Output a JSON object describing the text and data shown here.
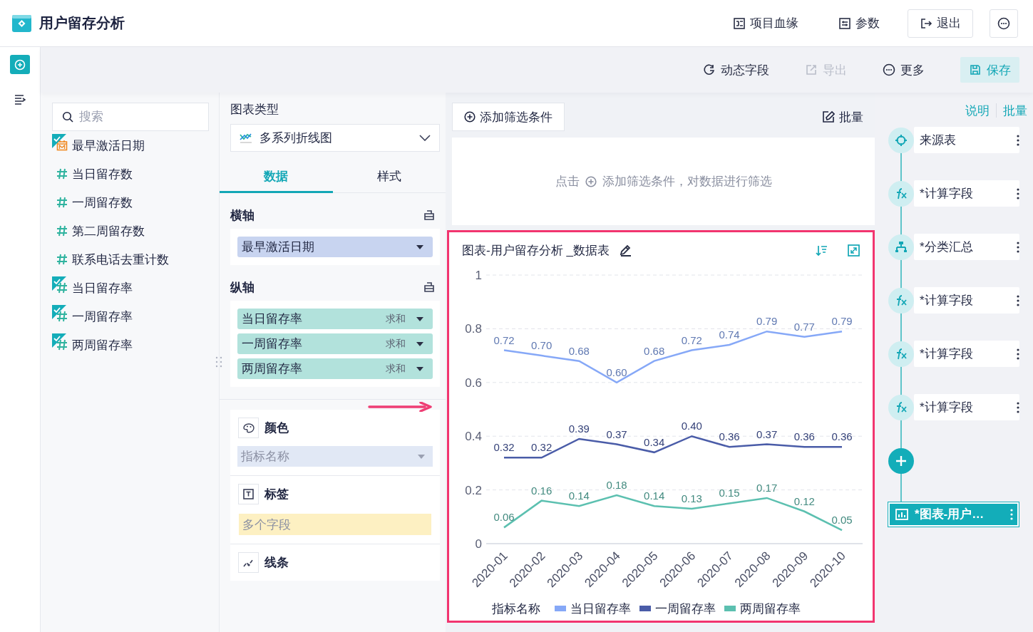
{
  "app": {
    "title": "用户留存分析"
  },
  "header_actions": [
    {
      "kind": "lineage",
      "label": "项目血缘"
    },
    {
      "kind": "params",
      "label": "参数"
    },
    {
      "kind": "exit",
      "label": "退出"
    },
    {
      "kind": "more"
    }
  ],
  "toolbar": [
    {
      "kind": "dynamic",
      "label": "动态字段",
      "disabled": false
    },
    {
      "kind": "export",
      "label": "导出",
      "disabled": true
    },
    {
      "kind": "more",
      "label": "更多",
      "disabled": false
    },
    {
      "kind": "save",
      "label": "保存",
      "disabled": false
    }
  ],
  "field_search": {
    "placeholder": "搜索"
  },
  "fields": [
    {
      "kind": "date",
      "label": "最早激活日期",
      "checked": true
    },
    {
      "kind": "number",
      "label": "当日留存数",
      "checked": false
    },
    {
      "kind": "number",
      "label": "一周留存数",
      "checked": false
    },
    {
      "kind": "number",
      "label": "第二周留存数",
      "checked": false
    },
    {
      "kind": "number",
      "label": "联系电话去重计数",
      "checked": false
    },
    {
      "kind": "number",
      "label": "当日留存率",
      "checked": true
    },
    {
      "kind": "number",
      "label": "一周留存率",
      "checked": true
    },
    {
      "kind": "number",
      "label": "两周留存率",
      "checked": true
    }
  ],
  "chart_type": {
    "label": "图表类型",
    "value": "多系列折线图"
  },
  "config_tabs": [
    {
      "label": "数据",
      "selected": true
    },
    {
      "label": "样式",
      "selected": false
    }
  ],
  "x_axis": {
    "title": "横轴",
    "fields": [
      {
        "label": "最早激活日期"
      }
    ]
  },
  "y_axis": {
    "title": "纵轴",
    "fields": [
      {
        "label": "当日留存率",
        "aggregation": "求和"
      },
      {
        "label": "一周留存率",
        "aggregation": "求和"
      },
      {
        "label": "两周留存率",
        "aggregation": "求和"
      }
    ]
  },
  "color_section": {
    "title": "颜色",
    "field": "指标名称"
  },
  "label_section": {
    "title": "标签",
    "field": "多个字段"
  },
  "line_section": {
    "title": "线条"
  },
  "filter": {
    "add_button": "添加筛选条件",
    "batch": "批量",
    "hint_before": "点击",
    "hint_after": "添加筛选条件，对数据进行筛选"
  },
  "chart_card": {
    "title": "图表-用户留存分析 _数据表",
    "legend_title": "指标名称",
    "chart_data": {
      "type": "line",
      "categories": [
        "2020-01",
        "2020-02",
        "2020-03",
        "2020-04",
        "2020-05",
        "2020-06",
        "2020-07",
        "2020-08",
        "2020-09",
        "2020-10"
      ],
      "series": [
        {
          "name": "当日留存率",
          "color": "#86a8f7",
          "values": [
            0.72,
            0.7,
            0.68,
            0.6,
            0.68,
            0.72,
            0.74,
            0.79,
            0.77,
            0.79
          ]
        },
        {
          "name": "一周留存率",
          "color": "#4a5ca8",
          "values": [
            0.32,
            0.32,
            0.39,
            0.37,
            0.34,
            0.4,
            0.36,
            0.37,
            0.36,
            0.36
          ]
        },
        {
          "name": "两周留存率",
          "color": "#5cc0b0",
          "values": [
            0.06,
            0.16,
            0.14,
            0.18,
            0.14,
            0.13,
            0.15,
            0.17,
            0.12,
            0.05
          ]
        }
      ],
      "ylim": [
        0,
        1
      ],
      "yticks": [
        0,
        0.2,
        0.4,
        0.6,
        0.8,
        1
      ],
      "grid": true,
      "value_labels": [
        [
          "0.72",
          "0.70",
          "0.68",
          "0.60",
          "0.68",
          "0.72",
          "0.74",
          "0.79",
          "0.77",
          "0.79"
        ],
        [
          "0.32",
          "0.32",
          "0.39",
          "0.37",
          "0.34",
          "0.40",
          "0.36",
          "0.37",
          "0.36",
          "0.36"
        ],
        [
          "0.06",
          "0.16",
          "0.14",
          "0.18",
          "0.14",
          "0.13",
          "0.15",
          "0.17",
          "0.12",
          "0.05"
        ]
      ]
    }
  },
  "flow": {
    "links": [
      "说明",
      "批量"
    ],
    "steps": [
      {
        "kind": "source",
        "label": "来源表",
        "selected": false
      },
      {
        "kind": "formula",
        "label": "*计算字段",
        "selected": false
      },
      {
        "kind": "group",
        "label": "*分类汇总",
        "selected": false
      },
      {
        "kind": "formula",
        "label": "*计算字段",
        "selected": false
      },
      {
        "kind": "formula",
        "label": "*计算字段",
        "selected": false
      },
      {
        "kind": "formula",
        "label": "*计算字段",
        "selected": false
      },
      {
        "kind": "chart",
        "label": "*图表-用户…",
        "selected": true
      }
    ]
  }
}
